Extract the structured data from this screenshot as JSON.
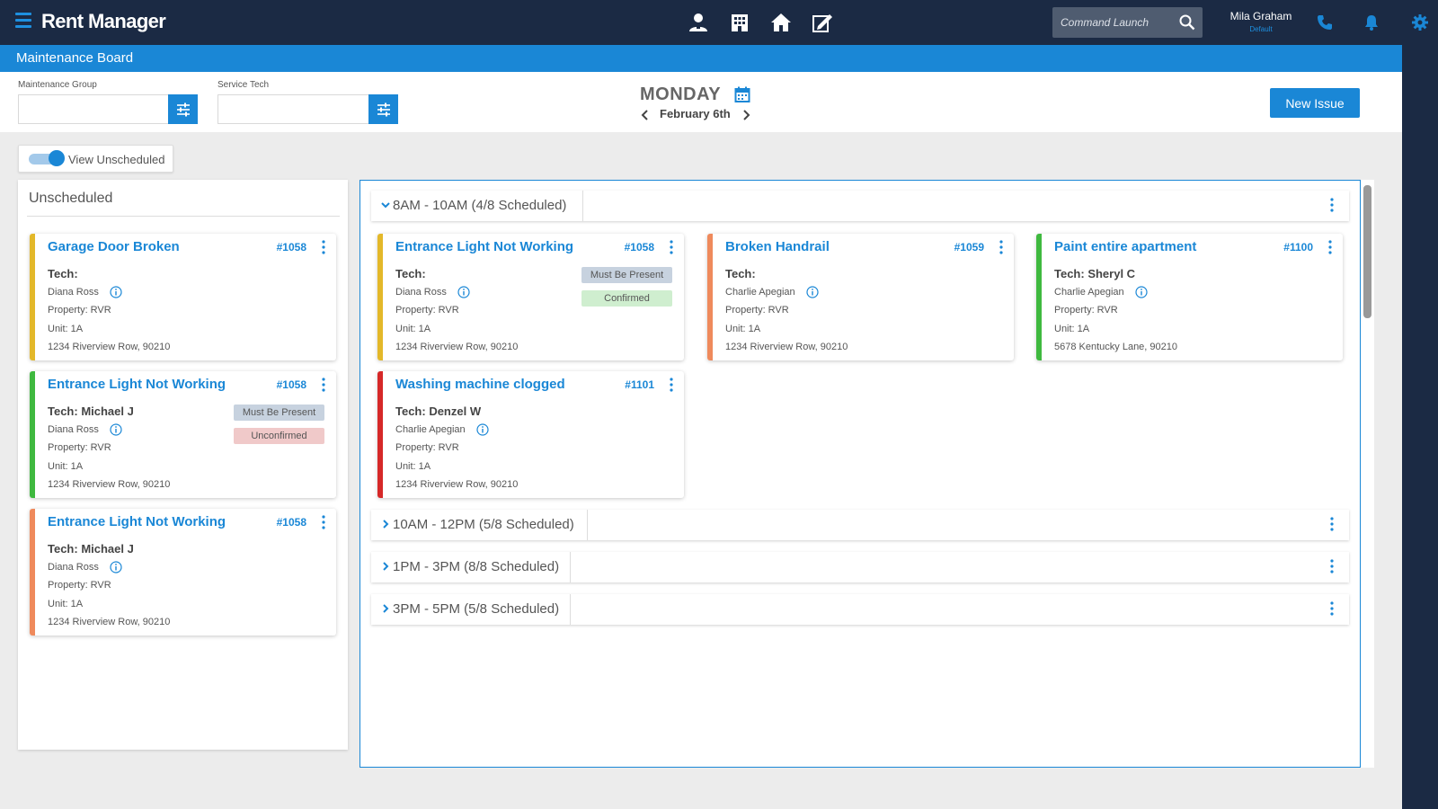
{
  "app": {
    "logo": "Rent Manager"
  },
  "header": {
    "command_placeholder": "Command Launch",
    "user_name": "Mila Graham",
    "user_role": "Default",
    "nav_icons": [
      "tenant-icon",
      "building-icon",
      "home-icon",
      "work-order-icon"
    ],
    "top_icons": [
      "phone-icon",
      "bell-icon",
      "gear-icon"
    ]
  },
  "page": {
    "title": "Maintenance Board"
  },
  "filters": {
    "maintenance_group_label": "Maintenance Group",
    "service_tech_label": "Service Tech",
    "maintenance_group_value": "",
    "service_tech_value": ""
  },
  "date": {
    "day": "MONDAY",
    "date": "February 6th"
  },
  "actions": {
    "new_issue": "New Issue"
  },
  "toggle": {
    "label": "View Unscheduled",
    "on": true
  },
  "unscheduled": {
    "title": "Unscheduled",
    "cards": [
      {
        "title": "Garage Door Broken",
        "number": "#1058",
        "tech": "Tech:",
        "person": "Diana Ross",
        "property": "Property: RVR",
        "unit": "Unit: 1A",
        "address": "1234 Riverview Row, 90210",
        "color": "#e3b82a",
        "badges": []
      },
      {
        "title": "Entrance Light Not Working",
        "number": "#1058",
        "tech": "Tech: Michael J",
        "person": "Diana Ross",
        "property": "Property: RVR",
        "unit": "Unit: 1A",
        "address": "1234 Riverview Row, 90210",
        "color": "#3fb93f",
        "badges": [
          {
            "label": "Must Be Present",
            "kind": "must"
          },
          {
            "label": "Unconfirmed",
            "kind": "unconf"
          }
        ]
      },
      {
        "title": "Entrance Light Not Working",
        "number": "#1058",
        "tech": "Tech: Michael J",
        "person": "Diana Ross",
        "property": "Property: RVR",
        "unit": "Unit: 1A",
        "address": "1234 Riverview Row, 90210",
        "color": "#ef8a5c",
        "badges": []
      }
    ]
  },
  "schedule": {
    "slots": [
      {
        "label": "8AM - 10AM (4/8 Scheduled)",
        "expanded": true
      },
      {
        "label": "10AM - 12PM (5/8 Scheduled)",
        "expanded": false
      },
      {
        "label": "1PM - 3PM (8/8 Scheduled)",
        "expanded": false
      },
      {
        "label": "3PM - 5PM (5/8 Scheduled)",
        "expanded": false
      }
    ],
    "cards": [
      {
        "title": "Entrance Light Not Working",
        "number": "#1058",
        "tech": "Tech:",
        "person": "Diana Ross",
        "property": "Property: RVR",
        "unit": "Unit: 1A",
        "address": "1234 Riverview Row, 90210",
        "color": "#e3b82a",
        "badges": [
          {
            "label": "Must Be Present",
            "kind": "must"
          },
          {
            "label": "Confirmed",
            "kind": "conf"
          }
        ]
      },
      {
        "title": "Broken Handrail",
        "number": "#1059",
        "tech": "Tech:",
        "person": "Charlie Apegian",
        "property": "Property: RVR",
        "unit": "Unit: 1A",
        "address": "1234 Riverview Row, 90210",
        "color": "#ef8a5c",
        "badges": []
      },
      {
        "title": "Paint entire apartment",
        "number": "#1100",
        "tech": "Tech: Sheryl C",
        "person": "Charlie Apegian",
        "property": "Property: RVR",
        "unit": "Unit: 1A",
        "address": "5678 Kentucky Lane, 90210",
        "color": "#3fb93f",
        "badges": []
      },
      {
        "title": "Washing machine clogged",
        "number": "#1101",
        "tech": "Tech: Denzel W",
        "person": "Charlie Apegian",
        "property": "Property: RVR",
        "unit": "Unit: 1A",
        "address": "1234 Riverview Row, 90210",
        "color": "#d62828",
        "badges": []
      }
    ]
  },
  "colors": {
    "accent": "#1a87d6",
    "navbar": "#1b2a44"
  }
}
